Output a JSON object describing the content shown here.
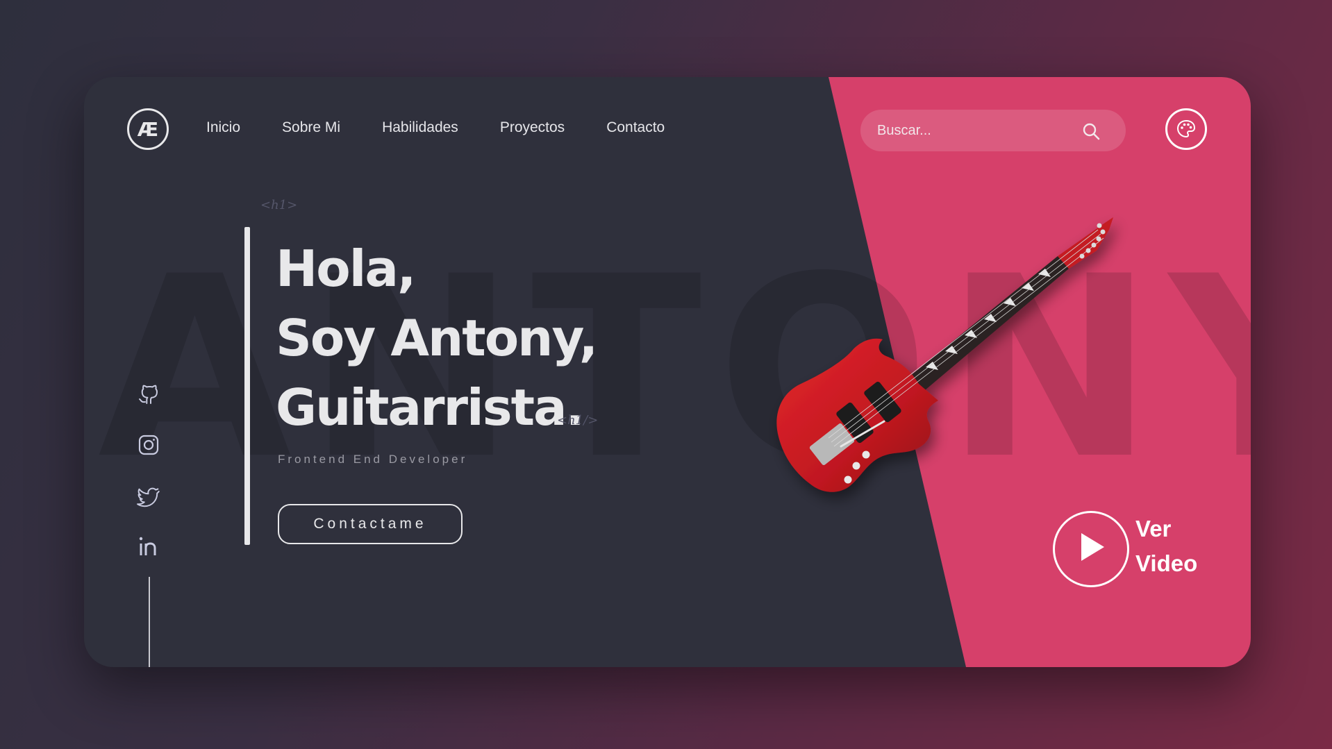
{
  "brand": {
    "logo_text": "Æ"
  },
  "nav": {
    "items": [
      {
        "label": "Inicio"
      },
      {
        "label": "Sobre Mi"
      },
      {
        "label": "Habilidades"
      },
      {
        "label": "Proyectos"
      },
      {
        "label": "Contacto"
      }
    ]
  },
  "search": {
    "placeholder": "Buscar...",
    "icon": "search-icon"
  },
  "theme_button": {
    "icon": "palette-icon"
  },
  "hero": {
    "background_word": "ANTONY",
    "tag_open": "<h1>",
    "tag_close": "<h1/>",
    "lines": [
      "Hola,",
      "Soy Antony,",
      "Guitarrista."
    ],
    "subtitle": "Frontend End Developer",
    "cta_label": "Contactame"
  },
  "socials": [
    {
      "icon": "github-icon"
    },
    {
      "icon": "instagram-icon"
    },
    {
      "icon": "twitter-icon"
    },
    {
      "icon": "linkedin-icon"
    }
  ],
  "video": {
    "line1": "Ver",
    "line2": "Video",
    "icon": "play-icon"
  },
  "colors": {
    "card_dark": "#2f303c",
    "accent_pink": "#d6406a",
    "text_light": "#e8e8ea",
    "guitar_red": "#c81820"
  }
}
